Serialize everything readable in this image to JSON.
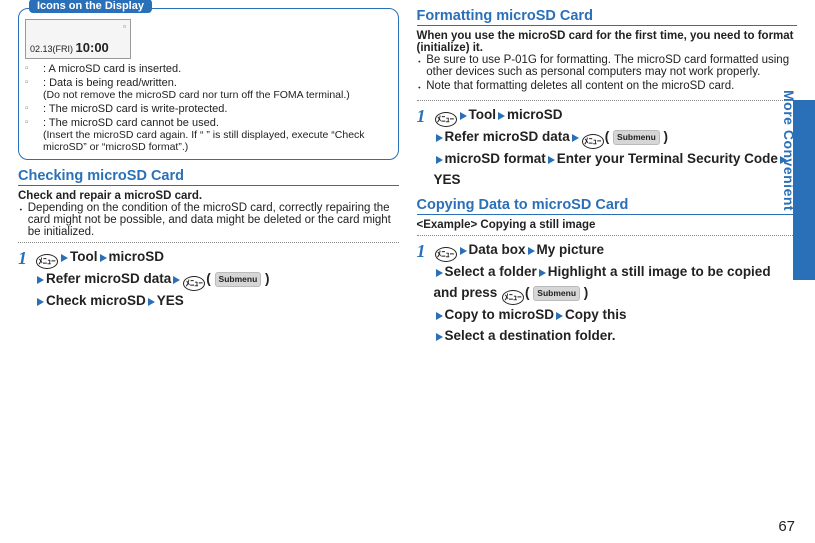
{
  "left": {
    "box": {
      "tab": "Icons on the Display",
      "phone": {
        "date": "02.13(FRI)",
        "time": "10:00"
      },
      "rows": [
        {
          "label": ": A microSD card is inserted."
        },
        {
          "label": ": Data is being read/written.",
          "note": "(Do not remove the microSD card nor turn off the FOMA terminal.)"
        },
        {
          "label": ": The microSD card is write-protected."
        },
        {
          "label": ": The microSD card cannot be used.",
          "note": "(Insert the microSD card again. If “ ” is still displayed, execute “Check microSD” or “microSD format”.)"
        }
      ]
    },
    "sec1": {
      "title": "Checking microSD Card",
      "sub": "Check and repair a microSD card.",
      "bullets": [
        "Depending on the condition of the microSD card, correctly repairing the card might not be possible, and data might be deleted or the card might be initialized."
      ],
      "step": {
        "tool": "Tool",
        "microsd": "microSD",
        "refer": "Refer microSD data",
        "submenu": "Submenu",
        "check": "Check microSD",
        "yes": "YES",
        "menu": "ﾒﾆｭｰ"
      }
    }
  },
  "right": {
    "sec1": {
      "title": "Formatting microSD Card",
      "sub": "When you use the microSD card for the first time, you need to format (initialize) it.",
      "bullets": [
        "Be sure to use P-01G for formatting. The microSD card formatted using other devices such as personal computers may not work properly.",
        "Note that formatting deletes all content on the microSD card."
      ],
      "step": {
        "tool": "Tool",
        "microsd": "microSD",
        "refer": "Refer microSD data",
        "submenu": "Submenu",
        "format": "microSD format",
        "enter": "Enter your Terminal Security Code",
        "yes": "YES",
        "menu": "ﾒﾆｭｰ"
      }
    },
    "sec2": {
      "title": "Copying Data to microSD Card",
      "sub": "<Example> Copying a still image",
      "step": {
        "databox": "Data box",
        "mypic": "My picture",
        "selfolder": "Select a folder",
        "highlight": "Highlight a still image to be copied and press",
        "submenu": "Submenu",
        "copyto": "Copy to microSD",
        "copythis": "Copy this",
        "seldest": "Select a destination folder.",
        "menu": "ﾒﾆｭｰ"
      }
    }
  },
  "side": "More Convenient",
  "page": "67"
}
